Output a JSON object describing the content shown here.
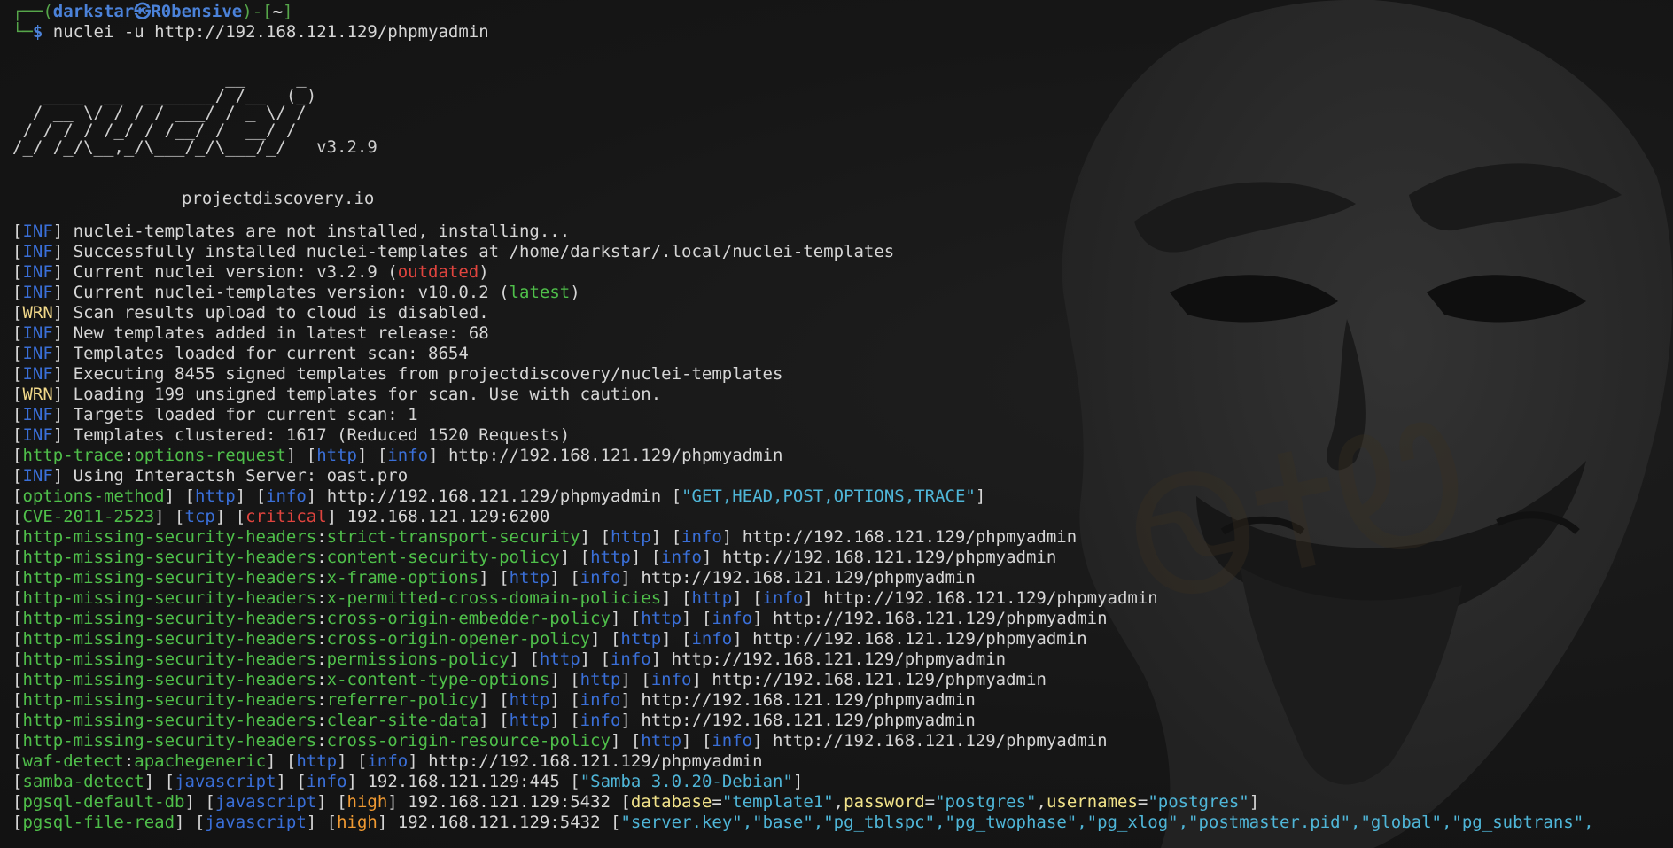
{
  "prompt": {
    "user": "darkstar",
    "separator": "㉿",
    "host": "R0bensive",
    "path": "~",
    "command": "nuclei -u http://192.168.121.129/phpmyadmin"
  },
  "banner": {
    "ascii": "                     __     _\n   ____  __  _______/ /__  (_)\n  / __ \\/ / / / ___/ / _ \\/ /\n / / / / /_/ / /__/ /  __/ /\n/_/ /_/\\__,_/\\___/_/\\___/_/   v3.2.9",
    "site": "projectdiscovery.io"
  },
  "tags": {
    "inf": "INF",
    "wrn": "WRN"
  },
  "log": [
    {
      "level": "INF",
      "text": "nuclei-templates are not installed, installing..."
    },
    {
      "level": "INF",
      "text": "Successfully installed nuclei-templates at /home/darkstar/.local/nuclei-templates"
    },
    {
      "level": "INF",
      "text": "Current nuclei version: v3.2.9 (",
      "highlight": "outdated",
      "after": ")"
    },
    {
      "level": "INF",
      "text": "Current nuclei-templates version: v10.0.2 (",
      "highlight": "latest",
      "after": ")"
    },
    {
      "level": "WRN",
      "text": "Scan results upload to cloud is disabled."
    },
    {
      "level": "INF",
      "text": "New templates added in latest release: 68"
    },
    {
      "level": "INF",
      "text": "Templates loaded for current scan: 8654"
    },
    {
      "level": "INF",
      "text": "Executing 8455 signed templates from projectdiscovery/nuclei-templates"
    },
    {
      "level": "WRN",
      "text": "Loading 199 unsigned templates for scan. Use with caution."
    },
    {
      "level": "INF",
      "text": "Targets loaded for current scan: 1"
    },
    {
      "level": "INF",
      "text": "Templates clustered: 1617 (Reduced 1520 Requests)"
    }
  ],
  "interactsh": {
    "level": "INF",
    "text": "Using Interactsh Server: oast.pro"
  },
  "results": [
    {
      "template": "http-trace",
      "matcher": "options-request",
      "protocol": "http",
      "severity": "info",
      "target": "http://192.168.121.129/phpmyadmin"
    },
    {
      "template": "options-method",
      "protocol": "http",
      "severity": "info",
      "target": "http://192.168.121.129/phpmyadmin",
      "extracted": "[\"GET,HEAD,POST,OPTIONS,TRACE\"]"
    },
    {
      "template": "CVE-2011-2523",
      "protocol": "tcp",
      "severity": "critical",
      "target": "192.168.121.129:6200"
    },
    {
      "template": "http-missing-security-headers",
      "matcher": "strict-transport-security",
      "protocol": "http",
      "severity": "info",
      "target": "http://192.168.121.129/phpmyadmin"
    },
    {
      "template": "http-missing-security-headers",
      "matcher": "content-security-policy",
      "protocol": "http",
      "severity": "info",
      "target": "http://192.168.121.129/phpmyadmin"
    },
    {
      "template": "http-missing-security-headers",
      "matcher": "x-frame-options",
      "protocol": "http",
      "severity": "info",
      "target": "http://192.168.121.129/phpmyadmin"
    },
    {
      "template": "http-missing-security-headers",
      "matcher": "x-permitted-cross-domain-policies",
      "protocol": "http",
      "severity": "info",
      "target": "http://192.168.121.129/phpmyadmin"
    },
    {
      "template": "http-missing-security-headers",
      "matcher": "cross-origin-embedder-policy",
      "protocol": "http",
      "severity": "info",
      "target": "http://192.168.121.129/phpmyadmin"
    },
    {
      "template": "http-missing-security-headers",
      "matcher": "cross-origin-opener-policy",
      "protocol": "http",
      "severity": "info",
      "target": "http://192.168.121.129/phpmyadmin"
    },
    {
      "template": "http-missing-security-headers",
      "matcher": "permissions-policy",
      "protocol": "http",
      "severity": "info",
      "target": "http://192.168.121.129/phpmyadmin"
    },
    {
      "template": "http-missing-security-headers",
      "matcher": "x-content-type-options",
      "protocol": "http",
      "severity": "info",
      "target": "http://192.168.121.129/phpmyadmin"
    },
    {
      "template": "http-missing-security-headers",
      "matcher": "referrer-policy",
      "protocol": "http",
      "severity": "info",
      "target": "http://192.168.121.129/phpmyadmin"
    },
    {
      "template": "http-missing-security-headers",
      "matcher": "clear-site-data",
      "protocol": "http",
      "severity": "info",
      "target": "http://192.168.121.129/phpmyadmin"
    },
    {
      "template": "http-missing-security-headers",
      "matcher": "cross-origin-resource-policy",
      "protocol": "http",
      "severity": "info",
      "target": "http://192.168.121.129/phpmyadmin"
    },
    {
      "template": "waf-detect",
      "matcher": "apachegeneric",
      "protocol": "http",
      "severity": "info",
      "target": "http://192.168.121.129/phpmyadmin"
    },
    {
      "template": "samba-detect",
      "protocol": "javascript",
      "severity": "info",
      "target": "192.168.121.129:445",
      "extracted": "[\"Samba 3.0.20-Debian\"]"
    },
    {
      "template": "pgsql-default-db",
      "protocol": "javascript",
      "severity": "high",
      "target": "192.168.121.129:5432",
      "kv": [
        {
          "key": "database",
          "value": "\"template1\""
        },
        {
          "key": "password",
          "value": "\"postgres\""
        },
        {
          "key": "usernames",
          "value": "\"postgres\""
        }
      ]
    },
    {
      "template": "pgsql-file-read",
      "protocol": "javascript",
      "severity": "high",
      "target": "192.168.121.129:5432",
      "extracted": "[\"server.key\",\"base\",\"pg_tblspc\",\"pg_twophase\",\"pg_xlog\",\"postmaster.pid\",\"global\",\"pg_subtrans\","
    }
  ],
  "colors": {
    "background": "#141414",
    "info_tag": "#3a6fd8",
    "warn_tag": "#f2d98a",
    "template_id": "#4fbf4a",
    "critical": "#e0443e",
    "high": "#f09a32",
    "extracted": "#4fb6d8"
  },
  "icons": {
    "wallpaper": "guy-fawkes-mask-icon"
  }
}
